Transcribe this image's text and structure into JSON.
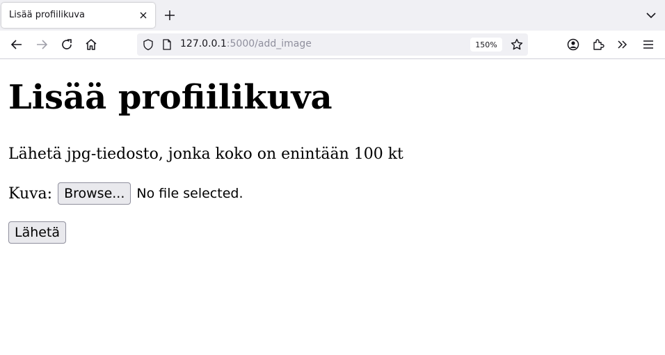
{
  "browser": {
    "tab": {
      "title": "Lisää profiilikuva"
    },
    "url": {
      "host": "127.0.0.1",
      "rest": ":5000/add_image"
    },
    "zoom": "150%",
    "icons": [
      "back-icon",
      "forward-icon",
      "reload-icon",
      "home-icon",
      "shield-icon",
      "page-icon",
      "bookmark-star-icon",
      "account-icon",
      "extensions-icon",
      "overflow-icon",
      "menu-icon",
      "close-icon",
      "plus-icon",
      "chevron-down-icon"
    ]
  },
  "page": {
    "title": "Lisää profiilikuva",
    "instructions": "Lähetä jpg-tiedosto, jonka koko on enintään 100 kt",
    "file_label": "Kuva:",
    "browse_label": "Browse...",
    "file_status": "No file selected.",
    "submit_label": "Lähetä"
  }
}
